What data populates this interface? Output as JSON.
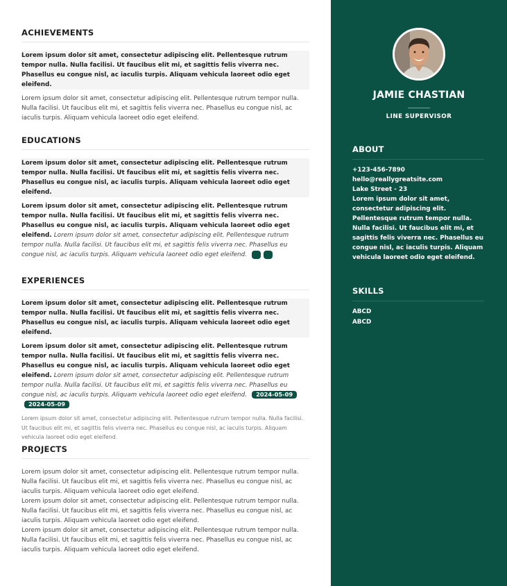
{
  "profile": {
    "name": "JAMIE CHASTIAN",
    "role": "LINE SUPERVISOR"
  },
  "about": {
    "title": "ABOUT",
    "phone": "+123-456-7890",
    "email": "hello@reallygreatsite.com",
    "address": "Lake Street - 23",
    "text": "Lorem ipsum dolor sit amet, consectetur adipiscing elit. Pellentesque rutrum tempor nulla. Nulla facilisi. Ut faucibus elit mi, et sagittis felis viverra nec. Phasellus eu congue nisl, ac iaculis turpis. Aliquam vehicula laoreet odio eget eleifend."
  },
  "skills": {
    "title": "SKILLS",
    "items": [
      "ABCD",
      "ABCD"
    ]
  },
  "achievements": {
    "title": "ACHIEVEMENTS",
    "bold_text": "Lorem ipsum dolor sit amet, consectetur adipiscing elit. Pellentesque rutrum tempor nulla. Nulla facilisi. Ut faucibus elit mi, et sagittis felis viverra nec. Phasellus eu congue nisl, ac iaculis turpis. Aliquam vehicula laoreet odio eget eleifend.",
    "text": "Lorem ipsum dolor sit amet, consectetur adipiscing elit. Pellentesque rutrum tempor nulla. Nulla facilisi. Ut faucibus elit mi, et sagittis felis viverra nec. Phasellus eu congue nisl, ac iaculis turpis. Aliquam vehicula laoreet odio eget eleifend."
  },
  "educations": {
    "title": "EDUCATIONS",
    "heading": "Lorem ipsum dolor sit amet, consectetur adipiscing elit. Pellentesque rutrum tempor nulla. Nulla facilisi. Ut faucibus elit mi, et sagittis felis viverra nec. Phasellus eu congue nisl, ac iaculis turpis. Aliquam vehicula laoreet odio eget eleifend.",
    "sub": "Lorem ipsum dolor sit amet, consectetur adipiscing elit. Pellentesque rutrum tempor nulla. Nulla facilisi. Ut faucibus elit mi, et sagittis felis viverra nec. Phasellus eu congue nisl, ac iaculis turpis. Aliquam vehicula laoreet odio eget eleifend.",
    "italic": "Lorem ipsum dolor sit amet, consectetur adipiscing elit. Pellentesque rutrum tempor nulla. Nulla facilisi. Ut faucibus elit mi, et sagittis felis viverra nec. Phasellus eu congue nisl, ac iaculis turpis. Aliquam vehicula laoreet odio eget eleifend."
  },
  "experiences": {
    "title": "EXPERIENCES",
    "heading": "Lorem ipsum dolor sit amet, consectetur adipiscing elit. Pellentesque rutrum tempor nulla. Nulla facilisi. Ut faucibus elit mi, et sagittis felis viverra nec. Phasellus eu congue nisl, ac iaculis turpis. Aliquam vehicula laoreet odio eget eleifend.",
    "sub": "Lorem ipsum dolor sit amet, consectetur adipiscing elit. Pellentesque rutrum tempor nulla. Nulla facilisi. Ut faucibus elit mi, et sagittis felis viverra nec. Phasellus eu congue nisl, ac iaculis turpis. Aliquam vehicula laoreet odio eget eleifend.",
    "italic": "Lorem ipsum dolor sit amet, consectetur adipiscing elit. Pellentesque rutrum tempor nulla. Nulla facilisi. Ut faucibus elit mi, et sagittis felis viverra nec. Phasellus eu congue nisl, ac iaculis turpis. Aliquam vehicula laoreet odio eget eleifend.",
    "date_start": "2024-05-09",
    "date_end": "2024-05-09",
    "note": "Lorem ipsum dolor sit amet, consectetur adipiscing elit. Pellentesque rutrum tempor nulla. Nulla facilisi. Ut faucibus elit mi, et sagittis felis viverra nec. Phasellus eu congue nisl, ac iaculis turpis. Aliquam vehicula laoreet odio eget eleifend."
  },
  "projects": {
    "title": "PROJECTS",
    "items": [
      "Lorem ipsum dolor sit amet, consectetur adipiscing elit. Pellentesque rutrum tempor nulla. Nulla facilisi. Ut faucibus elit mi, et sagittis felis viverra nec. Phasellus eu congue nisl, ac iaculis turpis. Aliquam vehicula laoreet odio eget eleifend.",
      "Lorem ipsum dolor sit amet, consectetur adipiscing elit. Pellentesque rutrum tempor nulla. Nulla facilisi. Ut faucibus elit mi, et sagittis felis viverra nec. Phasellus eu congue nisl, ac iaculis turpis. Aliquam vehicula laoreet odio eget eleifend.",
      "Lorem ipsum dolor sit amet, consectetur adipiscing elit. Pellentesque rutrum tempor nulla. Nulla facilisi. Ut faucibus elit mi, et sagittis felis viverra nec. Phasellus eu congue nisl, ac iaculis turpis. Aliquam vehicula laoreet odio eget eleifend."
    ]
  },
  "colors": {
    "sidebar": "#0b5245",
    "accent": "#0b5245"
  }
}
